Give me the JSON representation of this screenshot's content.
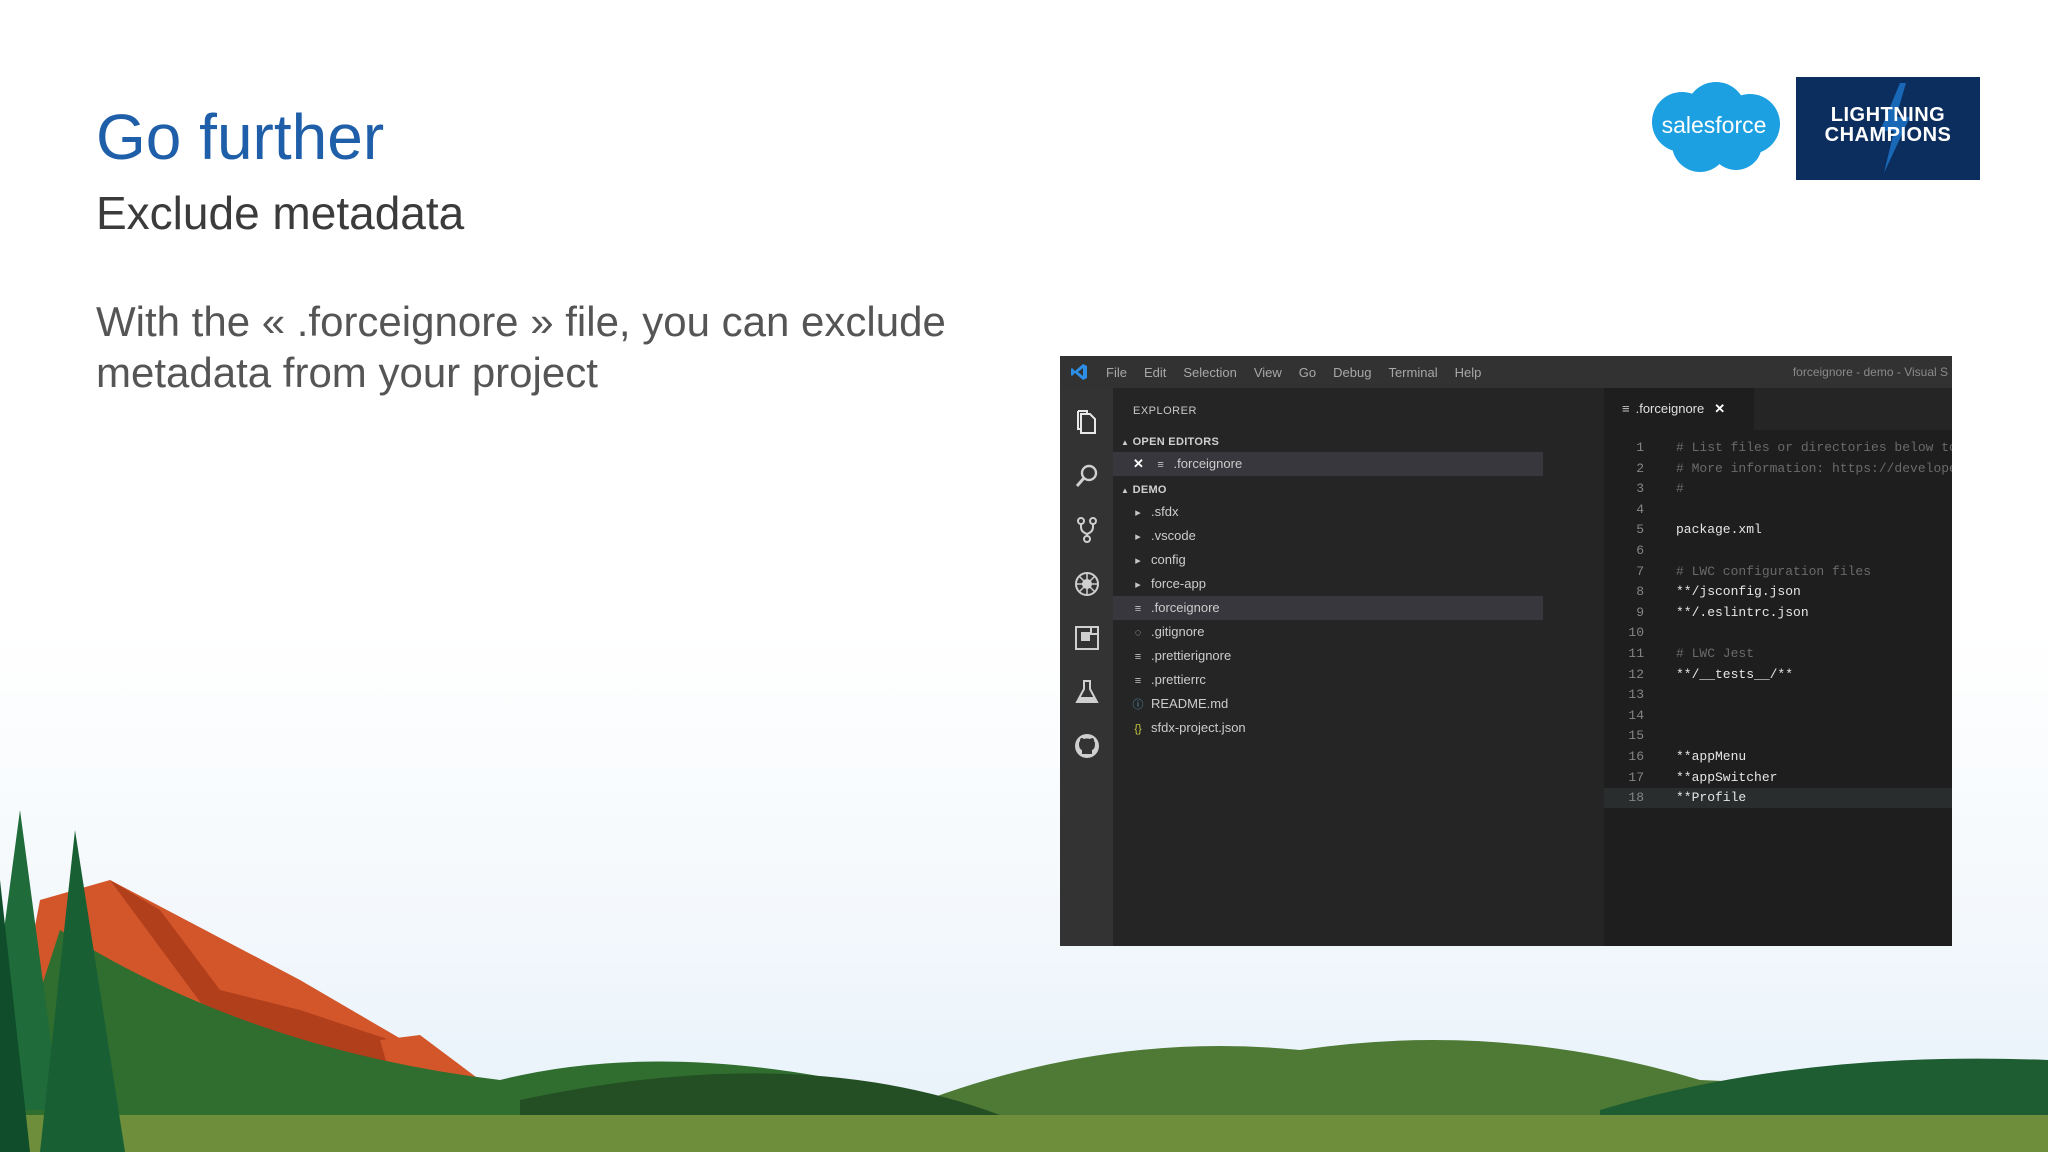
{
  "slide": {
    "title": "Go further",
    "subtitle": "Exclude metadata",
    "body": "With the « .forceignore » file, you can exclude metadata from your project"
  },
  "logos": {
    "salesforce": "salesforce",
    "champions_line1": "LIGHTNING",
    "champions_line2": "CHAMPIONS"
  },
  "vscode": {
    "menu": [
      "File",
      "Edit",
      "Selection",
      "View",
      "Go",
      "Debug",
      "Terminal",
      "Help"
    ],
    "window_title": "forceignore - demo - Visual S",
    "activity_icons": [
      "files-icon",
      "search-icon",
      "source-control-icon",
      "debug-icon",
      "extensions-icon",
      "test-icon",
      "github-icon"
    ],
    "explorer": {
      "title": "EXPLORER",
      "open_editors_label": "OPEN EDITORS",
      "open_editor_file": ".forceignore",
      "project_label": "DEMO",
      "items": [
        {
          "name": ".sfdx",
          "icon": "chevron-right-icon"
        },
        {
          "name": ".vscode",
          "icon": "chevron-right-icon"
        },
        {
          "name": "config",
          "icon": "chevron-right-icon"
        },
        {
          "name": "force-app",
          "icon": "chevron-right-icon"
        },
        {
          "name": ".forceignore",
          "icon": "lines-file-icon",
          "selected": true
        },
        {
          "name": ".gitignore",
          "icon": "git-file-icon"
        },
        {
          "name": ".prettierignore",
          "icon": "lines-file-icon"
        },
        {
          "name": ".prettierrc",
          "icon": "lines-file-icon"
        },
        {
          "name": "README.md",
          "icon": "info-file-icon"
        },
        {
          "name": "sfdx-project.json",
          "icon": "json-file-icon"
        }
      ]
    },
    "tab_label": ".forceignore",
    "code_lines": [
      {
        "n": "1",
        "text": "# List files or directories below to ig",
        "comment": true
      },
      {
        "n": "2",
        "text": "# More information: https://developer.sa",
        "comment": true
      },
      {
        "n": "3",
        "text": "#",
        "comment": true
      },
      {
        "n": "4",
        "text": ""
      },
      {
        "n": "5",
        "text": "package.xml"
      },
      {
        "n": "6",
        "text": ""
      },
      {
        "n": "7",
        "text": "# LWC configuration files",
        "comment": true
      },
      {
        "n": "8",
        "text": "**/jsconfig.json"
      },
      {
        "n": "9",
        "text": "**/.eslintrc.json"
      },
      {
        "n": "10",
        "text": ""
      },
      {
        "n": "11",
        "text": "# LWC Jest",
        "comment": true
      },
      {
        "n": "12",
        "text": "**/__tests__/**"
      },
      {
        "n": "13",
        "text": ""
      },
      {
        "n": "14",
        "text": ""
      },
      {
        "n": "15",
        "text": ""
      },
      {
        "n": "16",
        "text": "**appMenu"
      },
      {
        "n": "17",
        "text": "**appSwitcher"
      },
      {
        "n": "18",
        "text": "**Profile",
        "current": true
      }
    ]
  },
  "colors": {
    "title": "#1f5ea8",
    "salesforce_cloud": "#1ca0e1",
    "champions_bg": "#0b2e5e",
    "vscode_bg": "#1e1e1e",
    "sidebar_bg": "#252526"
  }
}
